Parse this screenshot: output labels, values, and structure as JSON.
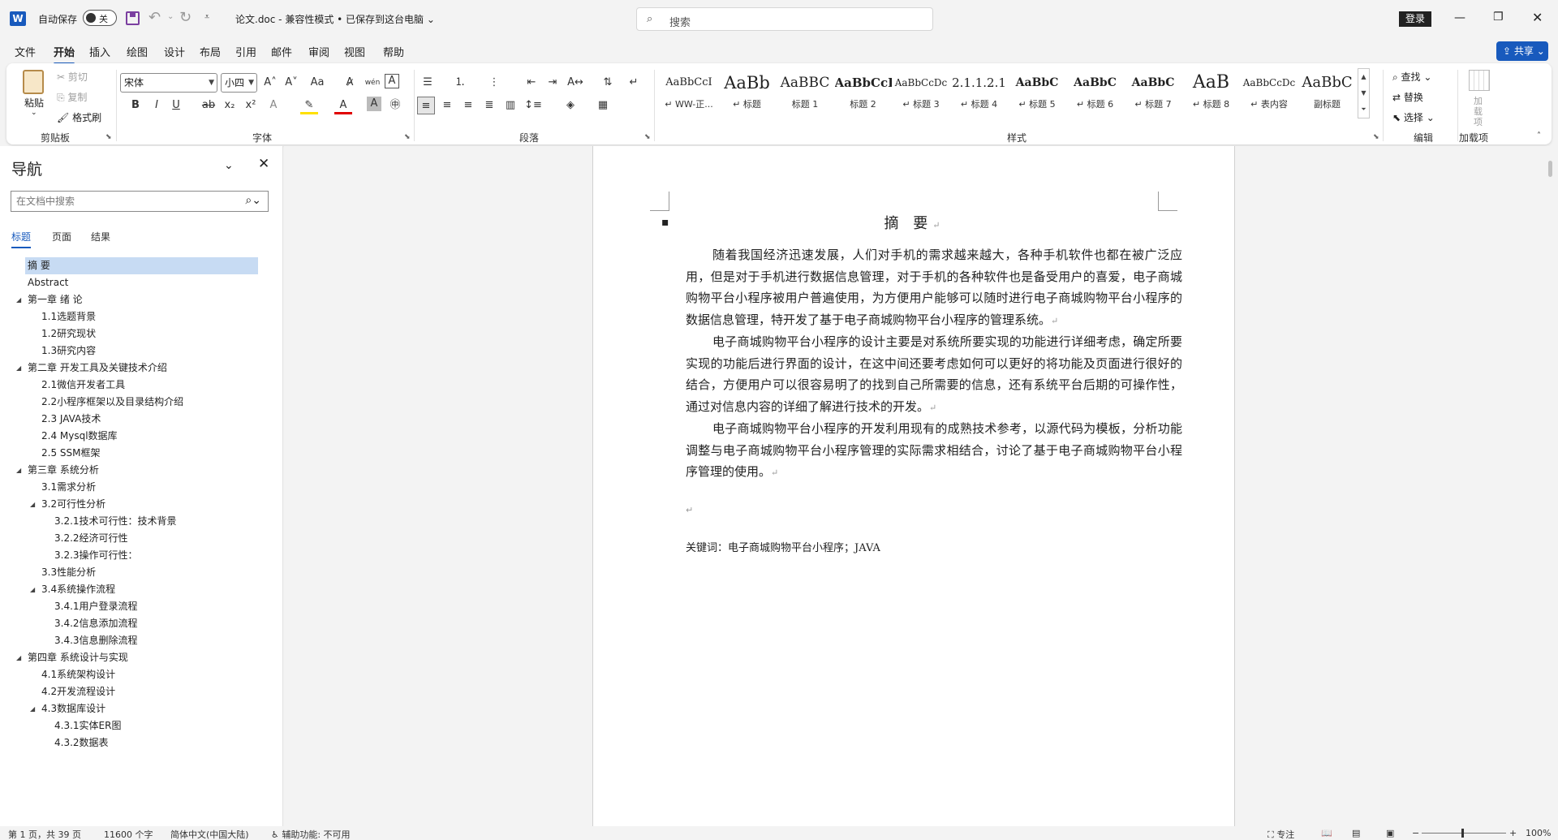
{
  "titlebar": {
    "autosave_label": "自动保存",
    "autosave_state": "关",
    "doc_title": "论文.doc  -  兼容性模式 • 已保存到这台电脑",
    "search_placeholder": "搜索",
    "login_label": "登录"
  },
  "menu": {
    "tabs": [
      "文件",
      "开始",
      "插入",
      "绘图",
      "设计",
      "布局",
      "引用",
      "邮件",
      "审阅",
      "视图",
      "帮助"
    ],
    "active": "开始",
    "share_label": "共享"
  },
  "ribbon": {
    "clipboard": {
      "paste": "粘贴",
      "cut": "剪切",
      "copy": "复制",
      "format_painter": "格式刷",
      "group": "剪贴板"
    },
    "font": {
      "name": "宋体",
      "size": "小四",
      "group": "字体"
    },
    "paragraph": {
      "group": "段落"
    },
    "styles": {
      "group": "样式",
      "items": [
        {
          "preview": "AaBbCcI",
          "name": "↵ WW-正..."
        },
        {
          "preview": "AaBb",
          "name": "↵ 标题"
        },
        {
          "preview": "AaBBC",
          "name": "标题 1"
        },
        {
          "preview": "AaBbCcI",
          "name": "标题 2"
        },
        {
          "preview": "AaBbCcDc",
          "name": "↵ 标题 3"
        },
        {
          "preview": "2.1.1.2.1",
          "name": "↵ 标题 4"
        },
        {
          "preview": "AaBbC",
          "name": "↵ 标题 5"
        },
        {
          "preview": "AaBbC",
          "name": "↵ 标题 6"
        },
        {
          "preview": "AaBbC",
          "name": "↵ 标题 7"
        },
        {
          "preview": "AaB",
          "name": "↵ 标题 8"
        },
        {
          "preview": "AaBbCcDc",
          "name": "↵ 表内容"
        },
        {
          "preview": "AaBbC",
          "name": "副标题"
        }
      ]
    },
    "editing": {
      "find": "查找",
      "replace": "替换",
      "select": "选择",
      "group": "编辑"
    },
    "addins": {
      "label": "加载项",
      "group": "加载项"
    }
  },
  "nav": {
    "title": "导航",
    "search_placeholder": "在文档中搜索",
    "tabs": [
      "标题",
      "页面",
      "结果"
    ],
    "headings": [
      {
        "text": "摘  要",
        "level": 1,
        "selected": true,
        "expander": false
      },
      {
        "text": "Abstract",
        "level": 1,
        "selected": false,
        "expander": false
      },
      {
        "text": "第一章 绪 论",
        "level": 1,
        "selected": false,
        "expander": true
      },
      {
        "text": "1.1选题背景",
        "level": 2,
        "selected": false,
        "expander": false
      },
      {
        "text": "1.2研究现状",
        "level": 2,
        "selected": false,
        "expander": false
      },
      {
        "text": "1.3研究内容",
        "level": 2,
        "selected": false,
        "expander": false
      },
      {
        "text": "第二章 开发工具及关键技术介绍",
        "level": 1,
        "selected": false,
        "expander": true
      },
      {
        "text": "2.1微信开发者工具",
        "level": 2,
        "selected": false,
        "expander": false
      },
      {
        "text": "2.2小程序框架以及目录结构介绍",
        "level": 2,
        "selected": false,
        "expander": false
      },
      {
        "text": "2.3 JAVA技术",
        "level": 2,
        "selected": false,
        "expander": false
      },
      {
        "text": "2.4  Mysql数据库",
        "level": 2,
        "selected": false,
        "expander": false
      },
      {
        "text": "2.5 SSM框架",
        "level": 2,
        "selected": false,
        "expander": false
      },
      {
        "text": "第三章 系统分析",
        "level": 1,
        "selected": false,
        "expander": true
      },
      {
        "text": "3.1需求分析",
        "level": 2,
        "selected": false,
        "expander": false
      },
      {
        "text": "3.2可行性分析",
        "level": 2,
        "selected": false,
        "expander": true
      },
      {
        "text": "3.2.1技术可行性：技术背景",
        "level": 3,
        "selected": false,
        "expander": false
      },
      {
        "text": "3.2.2经济可行性",
        "level": 3,
        "selected": false,
        "expander": false
      },
      {
        "text": "3.2.3操作可行性：",
        "level": 3,
        "selected": false,
        "expander": false
      },
      {
        "text": "3.3性能分析",
        "level": 2,
        "selected": false,
        "expander": false
      },
      {
        "text": "3.4系统操作流程",
        "level": 2,
        "selected": false,
        "expander": true
      },
      {
        "text": "3.4.1用户登录流程",
        "level": 3,
        "selected": false,
        "expander": false
      },
      {
        "text": "3.4.2信息添加流程",
        "level": 3,
        "selected": false,
        "expander": false
      },
      {
        "text": "3.4.3信息删除流程",
        "level": 3,
        "selected": false,
        "expander": false
      },
      {
        "text": "第四章 系统设计与实现",
        "level": 1,
        "selected": false,
        "expander": true
      },
      {
        "text": "4.1系统架构设计",
        "level": 2,
        "selected": false,
        "expander": false
      },
      {
        "text": "4.2开发流程设计",
        "level": 2,
        "selected": false,
        "expander": false
      },
      {
        "text": "4.3数据库设计",
        "level": 2,
        "selected": false,
        "expander": true
      },
      {
        "text": "4.3.1实体ER图",
        "level": 3,
        "selected": false,
        "expander": false
      },
      {
        "text": "4.3.2数据表",
        "level": 3,
        "selected": false,
        "expander": false
      }
    ]
  },
  "document": {
    "heading": "摘 要",
    "paragraphs": [
      "随着我国经济迅速发展，人们对手机的需求越来越大，各种手机软件也都在被广泛应用，但是对于手机进行数据信息管理，对于手机的各种软件也是备受用户的喜爱，电子商城购物平台小程序被用户普遍使用，为方便用户能够可以随时进行电子商城购物平台小程序的数据信息管理，特开发了基于电子商城购物平台小程序的管理系统。",
      "电子商城购物平台小程序的设计主要是对系统所要实现的功能进行详细考虑，确定所要实现的功能后进行界面的设计，在这中间还要考虑如何可以更好的将功能及页面进行很好的结合，方便用户可以很容易明了的找到自己所需要的信息，还有系统平台后期的可操作性，通过对信息内容的详细了解进行技术的开发。",
      "电子商城购物平台小程序的开发利用现有的成熟技术参考，以源代码为模板，分析功能调整与电子商城购物平台小程序管理的实际需求相结合，讨论了基于电子商城购物平台小程序管理的使用。"
    ],
    "keywords": "关键词：电子商城购物平台小程序；JAVA"
  },
  "status": {
    "page": "第 1 页，共 39 页",
    "words": "11600 个字",
    "language": "简体中文(中国大陆)",
    "accessibility": "辅助功能: 不可用",
    "focus": "专注",
    "zoom": "100%"
  }
}
